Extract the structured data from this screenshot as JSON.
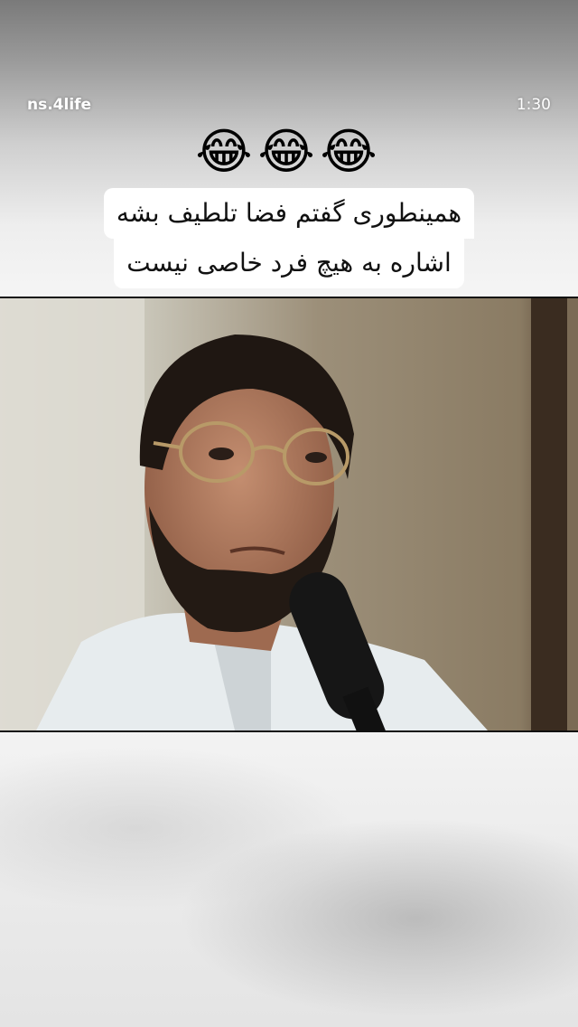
{
  "story": {
    "username": "ns.4life",
    "timestamp": "1:30",
    "emojis": "😂😂😂",
    "emoji_name": "face-with-tears-of-joy",
    "caption_line1": "همینطوری گفتم فضا تلطیف بشه",
    "caption_line2": "اشاره به هیچ فرد خاصی نیست"
  },
  "colors": {
    "caption_bg": "#ffffff",
    "caption_text": "#111111",
    "header_text": "#ffffff"
  }
}
